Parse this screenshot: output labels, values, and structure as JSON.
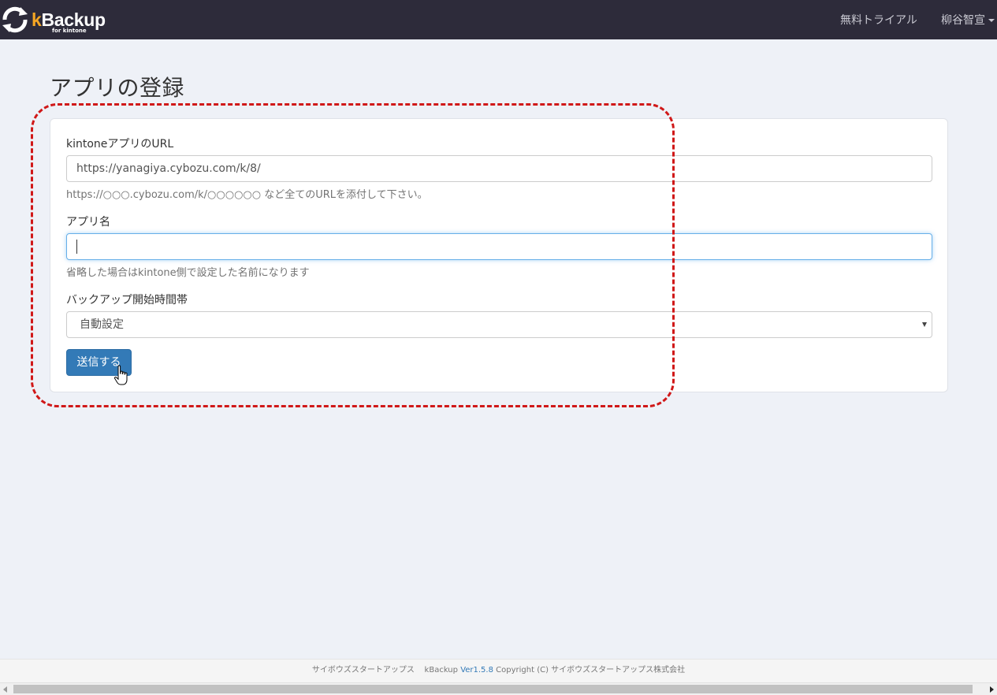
{
  "navbar": {
    "brand_k": "k",
    "brand_rest": "Backup",
    "brand_sub": "for kintone",
    "logo_icon": "refresh-arrows-icon",
    "trial_link": "無料トライアル",
    "user_name": "柳谷智宣"
  },
  "page": {
    "title": "アプリの登録"
  },
  "form": {
    "url_label": "kintoneアプリのURL",
    "url_value": "https://yanagiya.cybozu.com/k/8/",
    "url_help": "https://○○○.cybozu.com/k/○○○○○○ など全てのURLを添付して下さい。",
    "name_label": "アプリ名",
    "name_value": "",
    "name_help": "省略した場合はkintone側で設定した名前になります",
    "time_label": "バックアップ開始時間帯",
    "time_selected": "自動設定",
    "submit_label": "送信する"
  },
  "footer": {
    "company": "サイボウズスタートアップス",
    "product": "kBackup",
    "version": "Ver1.5.8",
    "copyright": "Copyright (C) サイボウズスタートアップス株式会社"
  },
  "colors": {
    "navbar_bg": "#2d2b3a",
    "brand_accent": "#f5a623",
    "primary_button": "#337ab7",
    "annotation": "#d01818",
    "page_bg": "#eef1f7"
  }
}
